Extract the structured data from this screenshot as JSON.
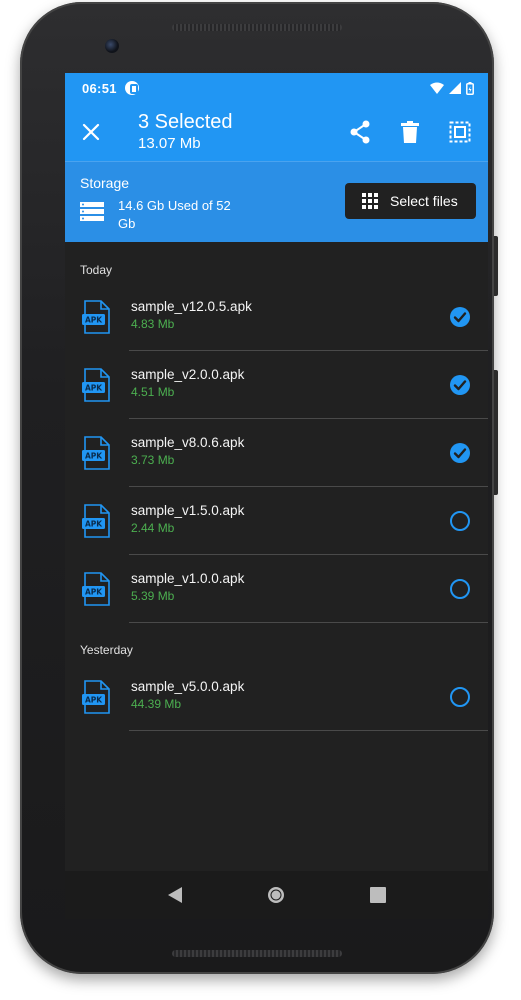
{
  "status": {
    "time": "06:51"
  },
  "appbar": {
    "title": "3 Selected",
    "subtitle": "13.07 Mb"
  },
  "storage": {
    "label": "Storage",
    "used": "14.6 Gb Used of 52 Gb",
    "select_files_label": "Select files"
  },
  "sections": {
    "today": "Today",
    "yesterday": "Yesterday"
  },
  "files": [
    {
      "name": "sample_v12.0.5.apk",
      "size": "4.83 Mb",
      "selected": true
    },
    {
      "name": "sample_v2.0.0.apk",
      "size": "4.51 Mb",
      "selected": true
    },
    {
      "name": "sample_v8.0.6.apk",
      "size": "3.73 Mb",
      "selected": true
    },
    {
      "name": "sample_v1.5.0.apk",
      "size": "2.44 Mb",
      "selected": false
    },
    {
      "name": "sample_v1.0.0.apk",
      "size": "5.39 Mb",
      "selected": false
    },
    {
      "name": "sample_v5.0.0.apk",
      "size": "44.39 Mb",
      "selected": false
    }
  ],
  "apk_badge": "APK",
  "icons": {
    "close": "close-icon",
    "share": "share-icon",
    "delete": "delete-icon",
    "select_all": "select-all-icon",
    "storage": "storage-icon",
    "grid": "grid-icon",
    "wifi": "wifi-icon",
    "signal": "signal-icon",
    "battery": "battery-icon",
    "back": "back-icon",
    "home": "home-icon",
    "recents": "recents-icon"
  },
  "colors": {
    "accent": "#2196f3",
    "background": "#212121",
    "size_text": "#4caf50"
  }
}
